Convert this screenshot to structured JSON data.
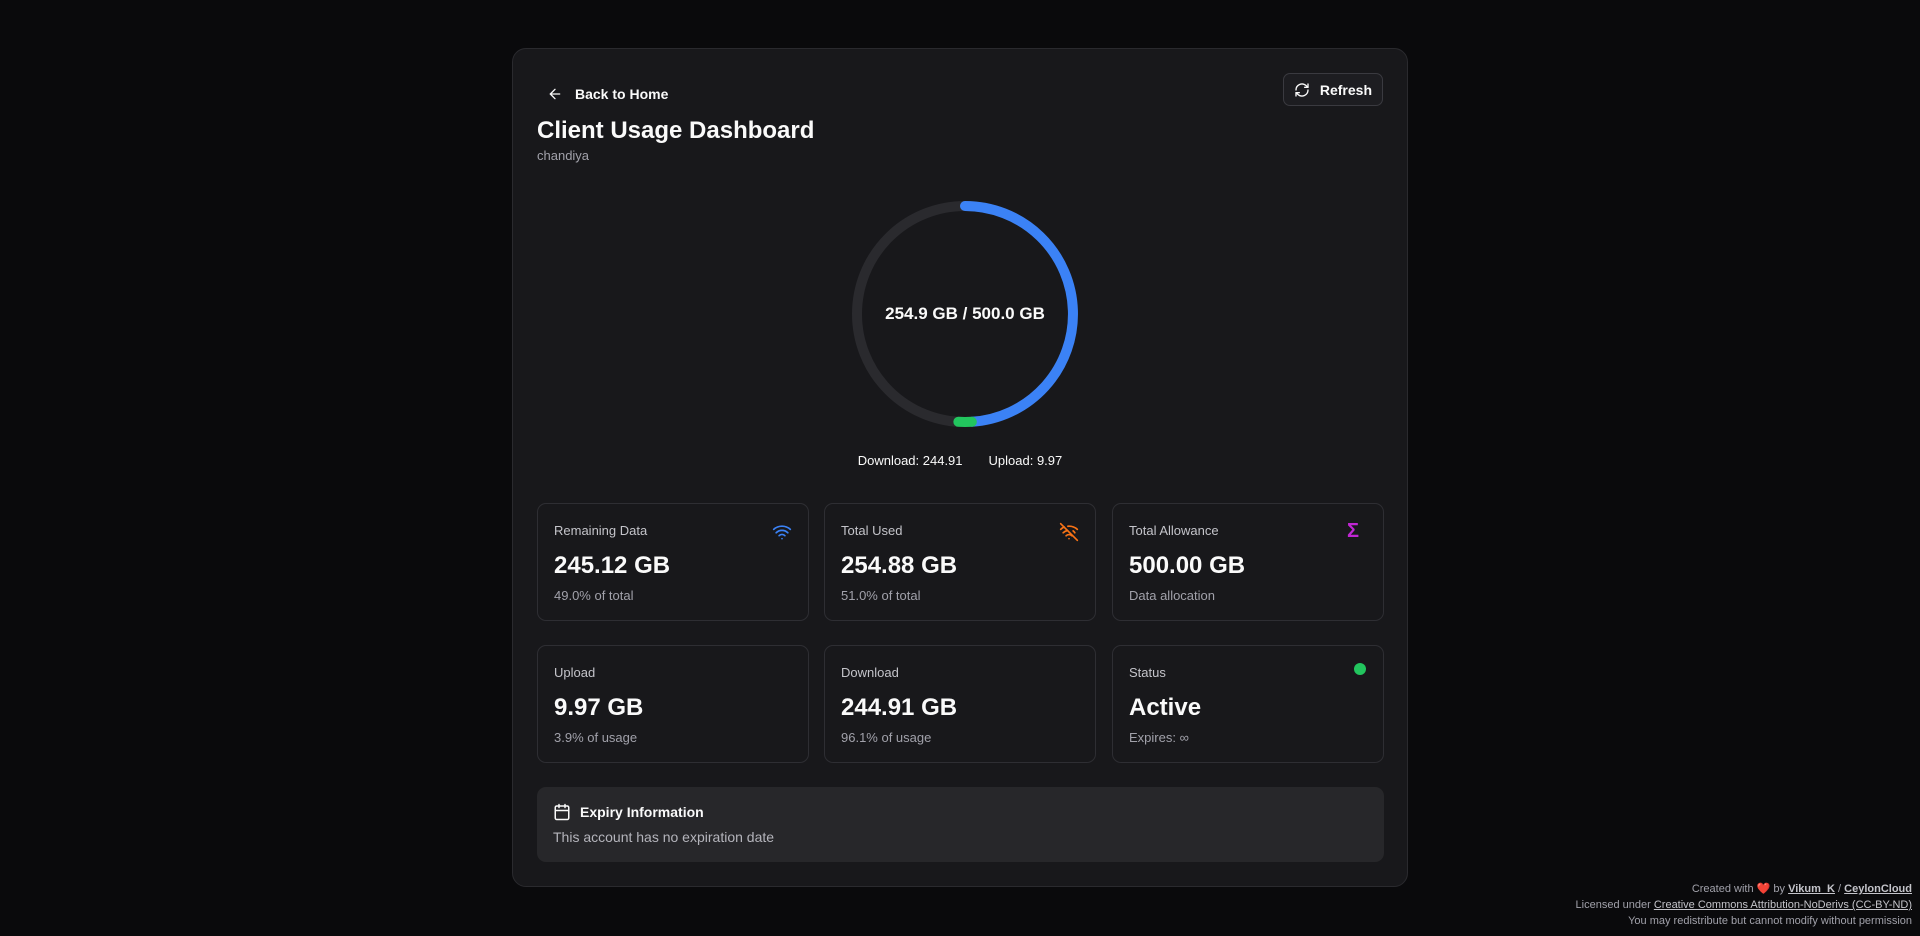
{
  "header": {
    "back_label": "Back to Home",
    "refresh_label": "Refresh",
    "title": "Client Usage Dashboard",
    "subtitle": "chandiya"
  },
  "gauge": {
    "center_text": "254.9 GB / 500.0 GB",
    "used_fraction": 0.5098,
    "upload_fraction": 0.0199,
    "download_label": "Download: 244.91",
    "upload_label": "Upload: 9.97",
    "colors": {
      "track": "#2a2a2e",
      "download": "#3b82f6",
      "upload": "#22c55e"
    }
  },
  "stats": {
    "remaining": {
      "label": "Remaining Data",
      "value": "245.12 GB",
      "sub": "49.0% of total",
      "icon": "wifi-icon",
      "color": "#3b82f6"
    },
    "used": {
      "label": "Total Used",
      "value": "254.88 GB",
      "sub": "51.0% of total",
      "icon": "wifi-off-icon",
      "color": "#f97316"
    },
    "allowance": {
      "label": "Total Allowance",
      "value": "500.00 GB",
      "sub": "Data allocation",
      "icon": "Σ",
      "color": "#c026d3"
    },
    "upload": {
      "label": "Upload",
      "value": "9.97 GB",
      "sub": "3.9% of usage"
    },
    "download": {
      "label": "Download",
      "value": "244.91 GB",
      "sub": "96.1% of usage"
    },
    "status": {
      "label": "Status",
      "value": "Active",
      "sub": "Expires: ∞",
      "color": "#22c55e"
    }
  },
  "expiry": {
    "title": "Expiry Information",
    "message": "This account has no expiration date"
  },
  "footer": {
    "created_with": "Created with",
    "by": "by",
    "author": "Vikum_K",
    "separator": "/",
    "org": "CeylonCloud",
    "licensed_under": "Licensed under",
    "license": "Creative Commons Attribution-NoDerivs (CC-BY-ND)",
    "notice": "You may redistribute but cannot modify without permission"
  }
}
